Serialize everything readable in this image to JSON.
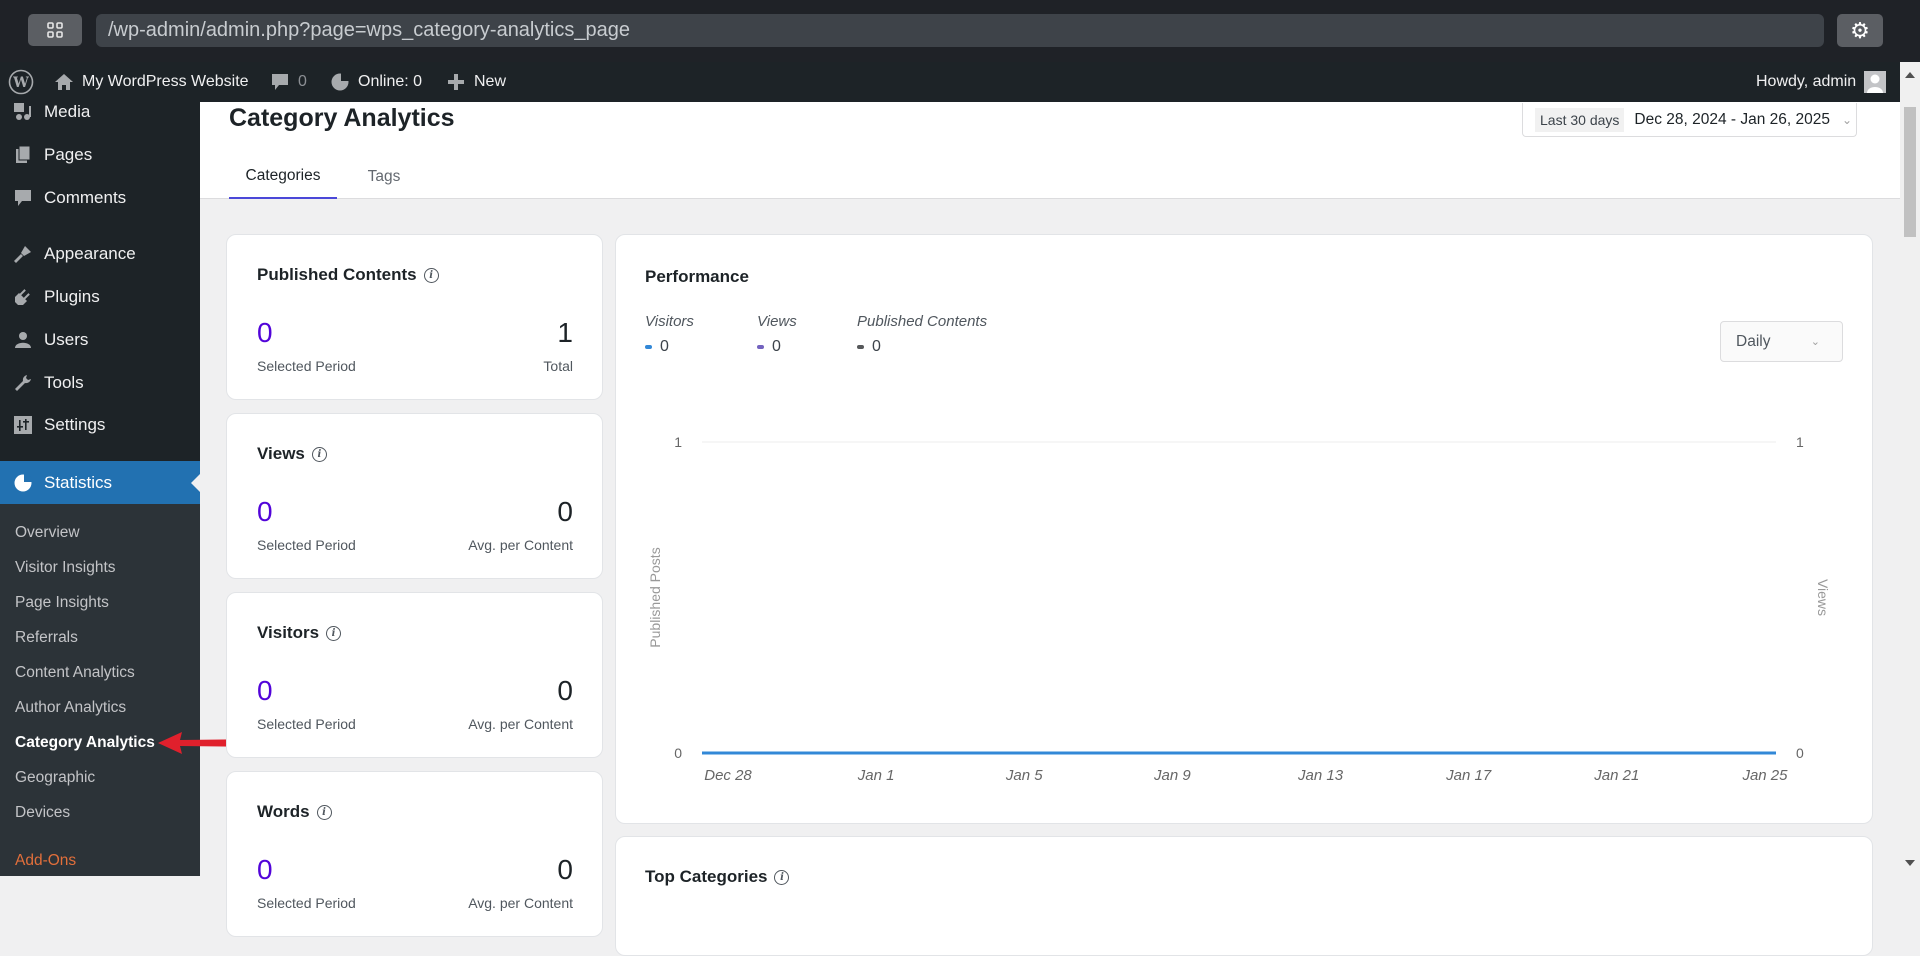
{
  "browser": {
    "url": "/wp-admin/admin.php?page=wps_category-analytics_page",
    "apps_icon": "grid-icon",
    "settings_icon": "gear-icon"
  },
  "adminbar": {
    "site_name": "My WordPress Website",
    "comments_count": "0",
    "online": "Online: 0",
    "new_label": "New",
    "howdy": "Howdy, admin"
  },
  "sidebar": {
    "items": [
      {
        "label": "Media",
        "icon": "media-icon"
      },
      {
        "label": "Pages",
        "icon": "pages-icon"
      },
      {
        "label": "Comments",
        "icon": "comments-icon"
      },
      {
        "label": "Appearance",
        "icon": "brush-icon"
      },
      {
        "label": "Plugins",
        "icon": "plugin-icon"
      },
      {
        "label": "Users",
        "icon": "user-icon"
      },
      {
        "label": "Tools",
        "icon": "wrench-icon"
      },
      {
        "label": "Settings",
        "icon": "settings-icon"
      },
      {
        "label": "Statistics",
        "icon": "pie-chart-icon",
        "active": true
      }
    ],
    "submenu": [
      {
        "label": "Overview"
      },
      {
        "label": "Visitor Insights"
      },
      {
        "label": "Page Insights"
      },
      {
        "label": "Referrals"
      },
      {
        "label": "Content Analytics"
      },
      {
        "label": "Author Analytics"
      },
      {
        "label": "Category Analytics",
        "current": true
      },
      {
        "label": "Geographic"
      },
      {
        "label": "Devices"
      },
      {
        "label": "Add-Ons",
        "highlight": true
      }
    ]
  },
  "page": {
    "title": "Category Analytics",
    "date_range": {
      "preset": "Last 30 days",
      "range": "Dec 28, 2024 - Jan 26, 2025"
    },
    "tabs": [
      {
        "label": "Categories",
        "active": true
      },
      {
        "label": "Tags",
        "active": false
      }
    ]
  },
  "stats": [
    {
      "title": "Published Contents",
      "left_value": "0",
      "left_label": "Selected Period",
      "right_value": "1",
      "right_label": "Total"
    },
    {
      "title": "Views",
      "left_value": "0",
      "left_label": "Selected Period",
      "right_value": "0",
      "right_label": "Avg. per Content"
    },
    {
      "title": "Visitors",
      "left_value": "0",
      "left_label": "Selected Period",
      "right_value": "0",
      "right_label": "Avg. per Content"
    },
    {
      "title": "Words",
      "left_value": "0",
      "left_label": "Selected Period",
      "right_value": "0",
      "right_label": "Avg. per Content"
    }
  ],
  "performance": {
    "title": "Performance",
    "legend": [
      {
        "label": "Visitors",
        "value": "0",
        "color": "#3288d7"
      },
      {
        "label": "Views",
        "value": "0",
        "color": "#7362bf"
      },
      {
        "label": "Published Contents",
        "value": "0",
        "color": "#56585a"
      }
    ],
    "interval": "Daily"
  },
  "top_categories": {
    "title": "Top Categories"
  },
  "chart_data": {
    "type": "line",
    "title": "Performance",
    "x": [
      "Dec 28",
      "Dec 29",
      "Dec 30",
      "Dec 31",
      "Jan 1",
      "Jan 2",
      "Jan 3",
      "Jan 4",
      "Jan 5",
      "Jan 6",
      "Jan 7",
      "Jan 8",
      "Jan 9",
      "Jan 10",
      "Jan 11",
      "Jan 12",
      "Jan 13",
      "Jan 14",
      "Jan 15",
      "Jan 16",
      "Jan 17",
      "Jan 18",
      "Jan 19",
      "Jan 20",
      "Jan 21",
      "Jan 22",
      "Jan 23",
      "Jan 24",
      "Jan 25",
      "Jan 26"
    ],
    "x_tick_labels": [
      "Dec 28",
      "Jan 1",
      "Jan 5",
      "Jan 9",
      "Jan 13",
      "Jan 17",
      "Jan 21",
      "Jan 25"
    ],
    "series": [
      {
        "name": "Visitors",
        "axis": "right",
        "color": "#3288d7",
        "values": [
          0,
          0,
          0,
          0,
          0,
          0,
          0,
          0,
          0,
          0,
          0,
          0,
          0,
          0,
          0,
          0,
          0,
          0,
          0,
          0,
          0,
          0,
          0,
          0,
          0,
          0,
          0,
          0,
          0,
          0
        ]
      },
      {
        "name": "Views",
        "axis": "right",
        "color": "#7362bf",
        "values": [
          0,
          0,
          0,
          0,
          0,
          0,
          0,
          0,
          0,
          0,
          0,
          0,
          0,
          0,
          0,
          0,
          0,
          0,
          0,
          0,
          0,
          0,
          0,
          0,
          0,
          0,
          0,
          0,
          0,
          0
        ]
      },
      {
        "name": "Published Contents",
        "axis": "left",
        "color": "#56585a",
        "values": [
          0,
          0,
          0,
          0,
          0,
          0,
          0,
          0,
          0,
          0,
          0,
          0,
          0,
          0,
          0,
          0,
          0,
          0,
          0,
          0,
          0,
          0,
          0,
          0,
          0,
          0,
          0,
          0,
          0,
          0
        ]
      }
    ],
    "ylabel": "Published Posts",
    "y2label": "Views",
    "ylim": [
      0,
      1
    ],
    "y2lim": [
      0,
      1
    ],
    "y_ticks": [
      "0",
      "1"
    ],
    "y2_ticks": [
      "0",
      "1"
    ],
    "grid": true
  }
}
